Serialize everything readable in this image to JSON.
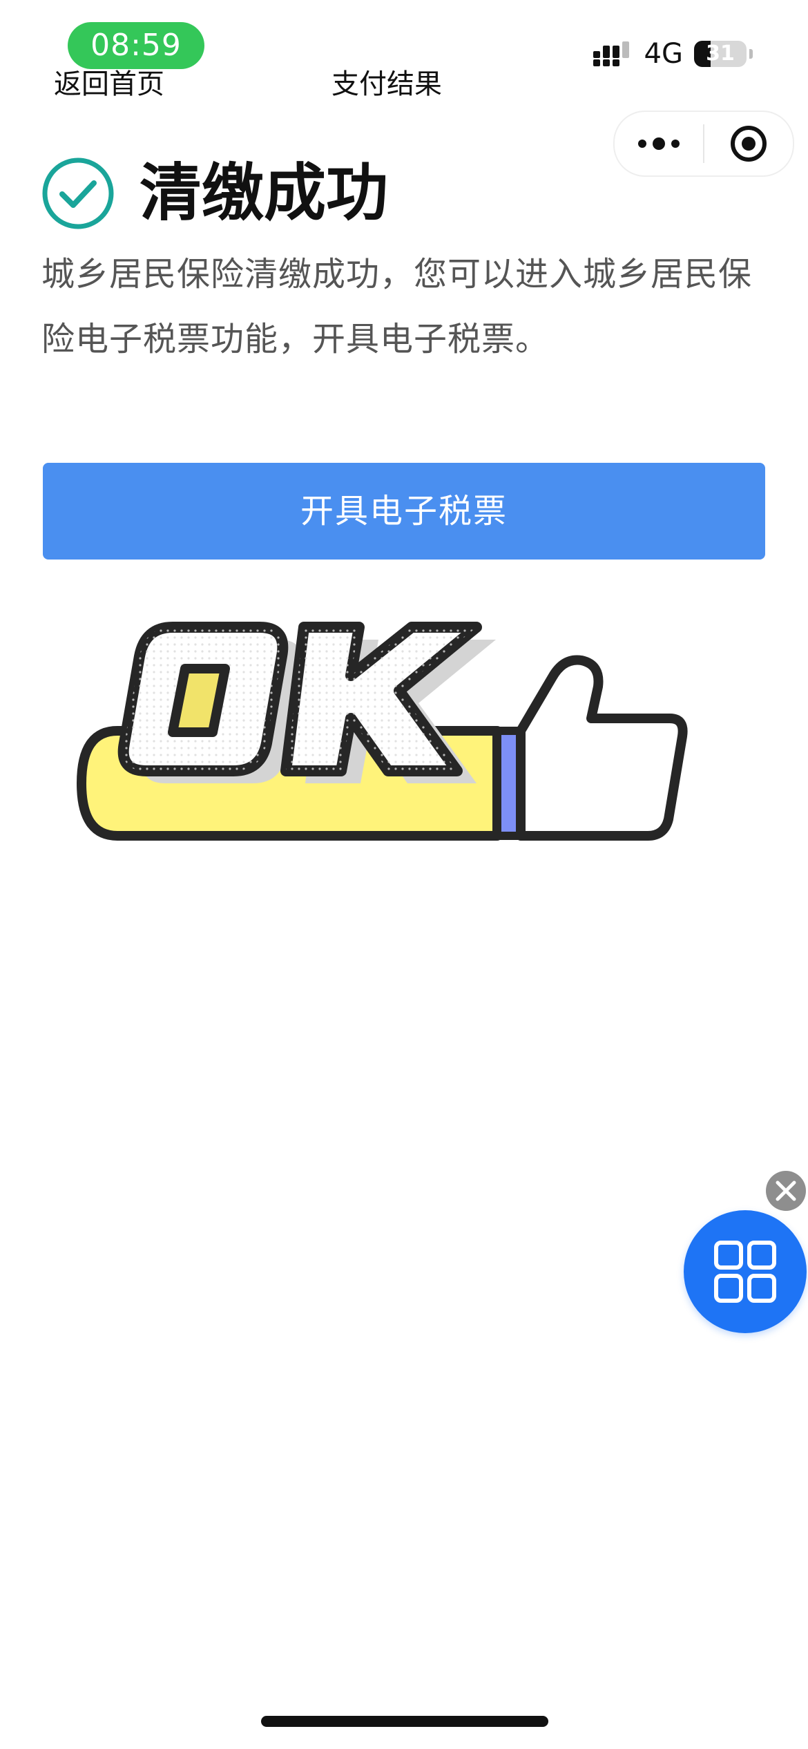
{
  "status_bar": {
    "time": "08:59",
    "network": "4G",
    "battery": "31",
    "battery_level": 0.31
  },
  "nav": {
    "back_label": "返回首页",
    "title": "支付结果"
  },
  "result": {
    "title": "清缴成功",
    "description": "城乡居民保险清缴成功，您可以进入城乡居民保险电子税票功能，开具电子税票。"
  },
  "actions": {
    "primary_label": "开具电子税票"
  },
  "illustration": {
    "text": "OK"
  },
  "colors": {
    "success": "#1aa59a",
    "primary": "#4a8ff0",
    "time_pill": "#34c759",
    "float_button": "#1e74f5"
  },
  "icons": [
    "check-circle-icon",
    "more-dots-icon",
    "target-icon",
    "close-icon",
    "grid-icon",
    "signal-icon"
  ]
}
